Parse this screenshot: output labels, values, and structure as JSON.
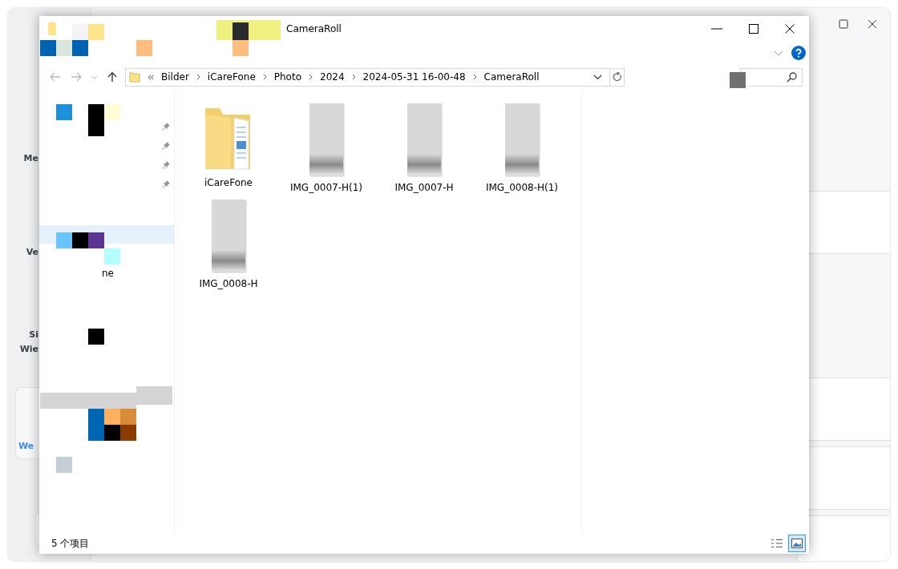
{
  "background_app": {
    "sidebar_labels": [
      "Me",
      "Ve",
      "Si\nWie"
    ],
    "card_label": "We"
  },
  "explorer": {
    "title": "CameraRoll",
    "breadcrumb": [
      "Bilder",
      "iCareFone",
      "Photo",
      "2024",
      "2024-05-31 16-00-48",
      "CameraRoll"
    ],
    "nav_pane": {
      "quick_access": [
        {
          "pinned": true
        },
        {
          "pinned": true
        },
        {
          "pinned": true
        },
        {
          "pinned": true
        }
      ],
      "locations": [
        {
          "selected": true
        },
        {
          "selected": false,
          "label": "ne"
        }
      ]
    },
    "files": [
      {
        "name": "iCareFone",
        "kind": "folder"
      },
      {
        "name": "IMG_0007-H(1)",
        "kind": "image"
      },
      {
        "name": "IMG_0007-H",
        "kind": "image"
      },
      {
        "name": "IMG_0008-H(1)",
        "kind": "image"
      },
      {
        "name": "IMG_0008-H",
        "kind": "image"
      }
    ],
    "status": "5 个项目",
    "views": [
      {
        "kind": "details",
        "selected": false
      },
      {
        "kind": "large_icons",
        "selected": true
      }
    ]
  }
}
